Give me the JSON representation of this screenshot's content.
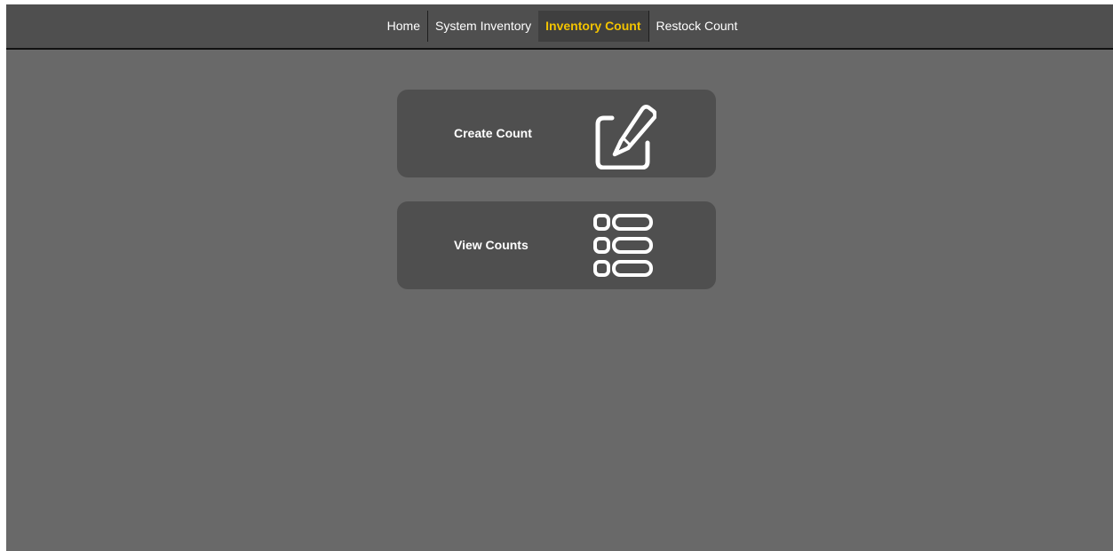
{
  "nav": {
    "items": [
      {
        "label": "Home"
      },
      {
        "label": "System Inventory"
      },
      {
        "label": "Inventory Count",
        "active": true
      },
      {
        "label": "Restock Count"
      }
    ]
  },
  "cards": {
    "create": {
      "label": "Create Count",
      "icon": "edit-square-icon"
    },
    "view": {
      "label": "View Counts",
      "icon": "list-view-icon"
    }
  },
  "colors": {
    "background": "#696969",
    "navbar": "#4f4f4f",
    "card": "#4f4f4f",
    "active_text": "#f2c300",
    "text": "#ffffff"
  }
}
